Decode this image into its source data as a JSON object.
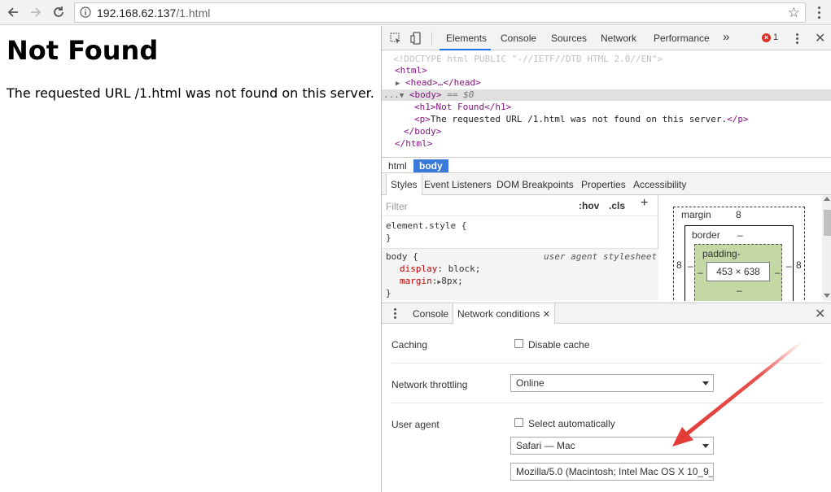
{
  "browser": {
    "url_host": "192.168.62.137",
    "url_path": "/1.html"
  },
  "page": {
    "heading": "Not Found",
    "message": "The requested URL /1.html was not found on this server."
  },
  "devtools": {
    "tabs": [
      "Elements",
      "Console",
      "Sources",
      "Network",
      "Performance"
    ],
    "more_tabs": "»",
    "error_count": "1",
    "dom": {
      "doctype": "<!DOCTYPE html PUBLIC \"-//IETF//DTD HTML 2.0//EN\">",
      "html_open": "<html>",
      "head": "<head>…</head>",
      "body_open": "<body>",
      "body_suffix": " == $0",
      "h1_line": "<h1>Not Found</h1>",
      "p_line_open": "<p>",
      "p_text": "The requested URL /1.html was not found on this server.",
      "p_line_close": "</p>",
      "body_close": "</body>",
      "html_close": "</html>",
      "ellipsis": "..."
    },
    "breadcrumbs": [
      "html",
      "body"
    ],
    "subtabs": [
      "Styles",
      "Event Listeners",
      "DOM Breakpoints",
      "Properties",
      "Accessibility"
    ],
    "styles": {
      "filter_placeholder": "Filter",
      "hov": ":hov",
      "cls": ".cls",
      "plus": "+",
      "element_style": "element.style {",
      "close_brace": "}",
      "body_selector": "body {",
      "source": "user agent stylesheet",
      "display_prop": "display",
      "display_val": ": block;",
      "margin_prop": "margin",
      "margin_val": "8px;"
    },
    "box_model": {
      "margin_label": "margin",
      "margin_value": "8",
      "border_label": "border",
      "border_value": "–",
      "padding_label": "padding-",
      "content_size": "453 × 638",
      "side_margin": "8",
      "side_dash": "–"
    },
    "drawer_tabs": [
      "Console",
      "Network conditions"
    ],
    "network_conditions": {
      "caching_label": "Caching",
      "disable_cache": "Disable cache",
      "throttling_label": "Network throttling",
      "throttling_value": "Online",
      "user_agent_label": "User agent",
      "select_automatically": "Select automatically",
      "user_agent_value": "Safari — Mac",
      "user_agent_string": "Mozilla/5.0 (Macintosh; Intel Mac OS X 10_9_"
    }
  },
  "colors": {
    "accent": "#1a73e8",
    "breadcrumb_active": "#3879d9",
    "tag": "#881280",
    "css_property": "#c80000",
    "padding_box": "#c3d8a4",
    "annotation_arrow": "#e33b36",
    "error_badge": "#d93025"
  },
  "icons": [
    "back-icon",
    "forward-icon",
    "reload-icon",
    "info-icon",
    "star-icon",
    "menu-icon",
    "inspect-icon",
    "device-toolbar-icon",
    "close-icon",
    "error-icon"
  ]
}
